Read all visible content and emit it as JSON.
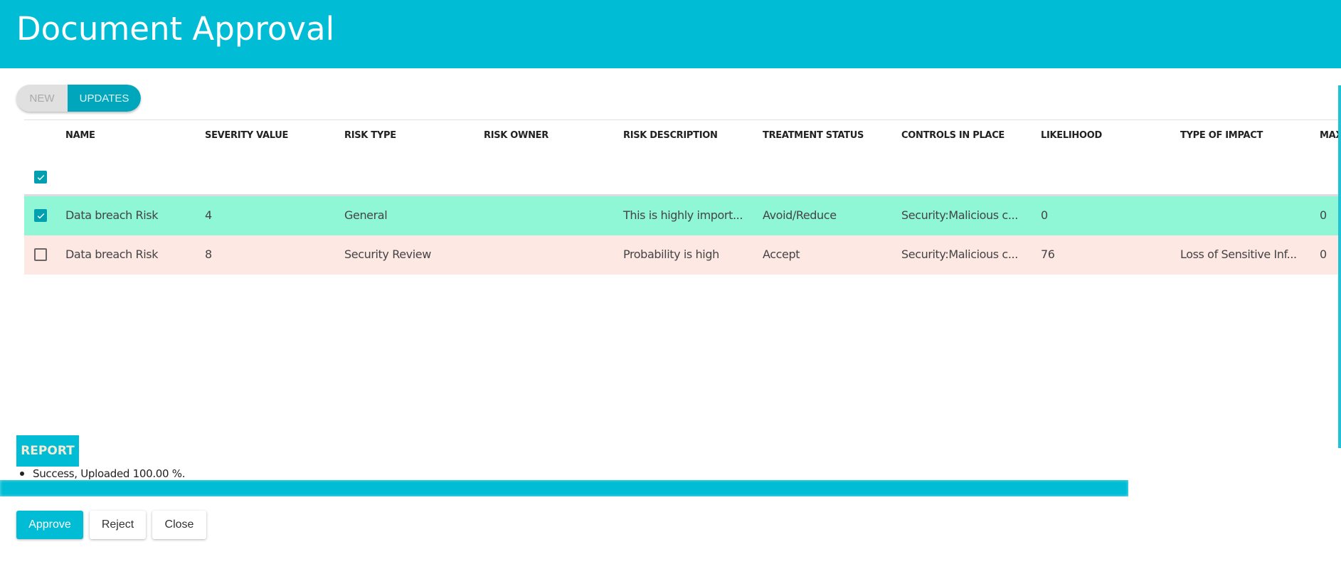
{
  "header": {
    "title": "Document Approval"
  },
  "toggle": {
    "options": [
      {
        "label": "NEW",
        "selected": false
      },
      {
        "label": "UPDATES",
        "selected": true
      }
    ]
  },
  "table": {
    "columns": [
      "NAME",
      "SEVERITY VALUE",
      "RISK TYPE",
      "RISK OWNER",
      "RISK DESCRIPTION",
      "TREATMENT STATUS",
      "CONTROLS IN PLACE",
      "LIKELIHOOD",
      "TYPE OF IMPACT",
      "MAX"
    ],
    "select_all_checked": true,
    "rows": [
      {
        "checked": true,
        "status_color": "#8ff7d6",
        "cells": [
          "Data breach Risk",
          "4",
          "General",
          "",
          "This is highly import...",
          "Avoid/Reduce",
          "Security:Malicious c...",
          "0",
          "",
          "0"
        ]
      },
      {
        "checked": false,
        "status_color": "#fde8e4",
        "cells": [
          "Data breach Risk",
          "8",
          "Security Review",
          "",
          "Probability is high",
          "Accept",
          "Security:Malicious c...",
          "76",
          "Loss of Sensitive Inf...",
          "0"
        ]
      }
    ]
  },
  "report": {
    "label": "REPORT",
    "messages": [
      "Success, Uploaded 100.00 %."
    ],
    "progress_percent": 100
  },
  "actions": {
    "approve": "Approve",
    "reject": "Reject",
    "close": "Close"
  },
  "colors": {
    "accent": "#00bcd4",
    "toggle_selected": "#00a6bb",
    "row_approved": "#8ff7d6",
    "row_pending": "#fde8e4"
  }
}
